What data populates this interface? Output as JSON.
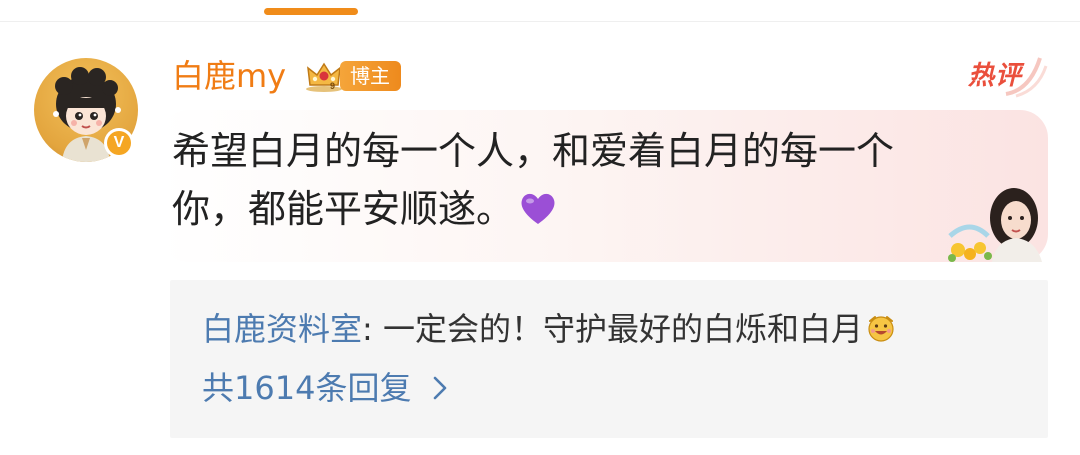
{
  "comment": {
    "username": "白鹿my",
    "role_badge": "博主",
    "hot_tag": "热评",
    "text": "希望白月的每一个人，和爱着白月的每一个你，都能平安顺遂。",
    "verified_label": "V",
    "emoji": "purple-heart"
  },
  "reply": {
    "author": "白鹿资料室",
    "separator": ": ",
    "text": "一定会的！守护最好的白烁和白月",
    "emoji": "cheering-smile",
    "count_label": "共1614条回复"
  },
  "colors": {
    "username": "#f07c14",
    "accent": "#f08c1a",
    "hot_tag": "#ea4f3c",
    "reply_author": "#4d7bb0",
    "reply_box_bg": "#f5f5f5",
    "text": "#222222"
  }
}
